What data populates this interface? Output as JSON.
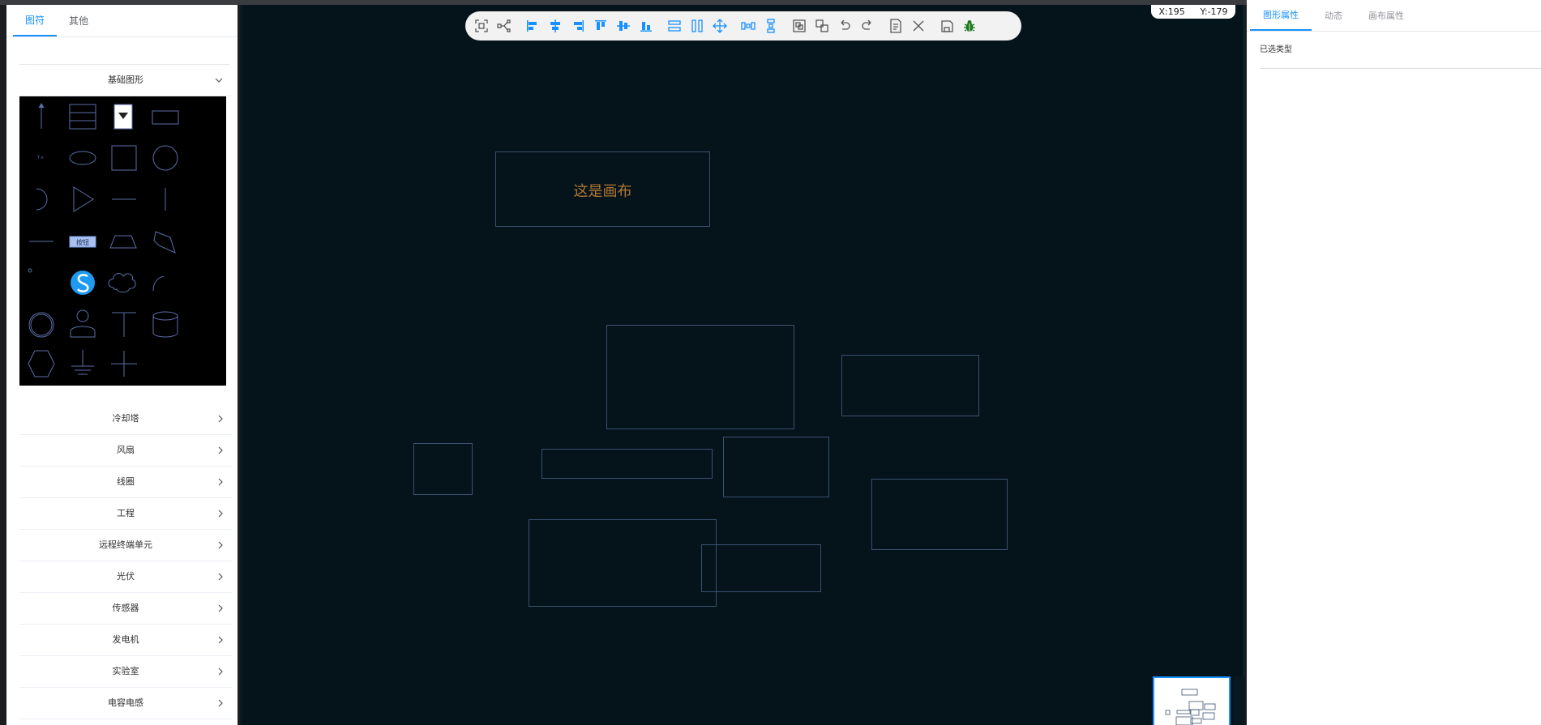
{
  "left_panel": {
    "tabs": [
      "图符",
      "其他"
    ],
    "active_tab": "图符",
    "expanded_category": "基础图形",
    "categories": [
      "冷却塔",
      "风扇",
      "线圈",
      "工程",
      "远程终端单元",
      "光伏",
      "传感器",
      "发电机",
      "实验室",
      "电容电感"
    ],
    "button_shape_label": "按钮"
  },
  "toolbar": {
    "icons": [
      "fit-view-icon",
      "branch-icon",
      "align-left-icon",
      "align-center-icon",
      "align-right-icon",
      "align-top-icon",
      "align-middle-icon",
      "align-bottom-icon",
      "same-width-icon",
      "same-height-icon",
      "move-icon",
      "distribute-horizontal-icon",
      "distribute-vertical-icon",
      "group-icon",
      "ungroup-icon",
      "undo-icon",
      "redo-icon",
      "preview-icon",
      "clear-icon",
      "save-icon",
      "debug-icon"
    ]
  },
  "coordinates": {
    "x_label": "X:195",
    "y_label": "Y:-179"
  },
  "canvas": {
    "text": "这是画布",
    "background": "#05131a",
    "stroke_color": "#3a5270",
    "text_color": "#b07835"
  },
  "right_panel": {
    "tabs": [
      "图形属性",
      "动态",
      "画布属性"
    ],
    "active_tab": "图形属性",
    "selected_type_label": "已选类型"
  },
  "colors": {
    "accent": "#1890ff"
  }
}
